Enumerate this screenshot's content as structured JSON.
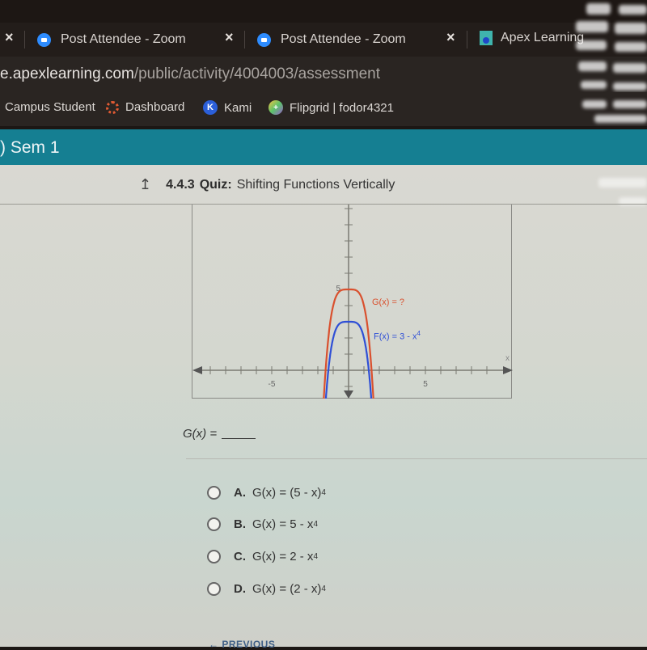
{
  "browser": {
    "tabs": [
      {
        "label": "Post Attendee - Zoom",
        "icon": "zoom-icon"
      },
      {
        "label": "Post Attendee - Zoom",
        "icon": "zoom-icon"
      },
      {
        "label": "Apex Learning",
        "icon": "apex-learning-icon"
      }
    ],
    "close_glyph": "×",
    "url_host": "e.apexlearning.com",
    "url_path": "/public/activity/4004003/assessment",
    "bookmarks": [
      {
        "label": "Campus Student",
        "icon": ""
      },
      {
        "label": "Dashboard",
        "icon": "dashboard-ring-icon"
      },
      {
        "label": "Kami",
        "icon": "kami-icon",
        "glyph": "K"
      },
      {
        "label": "Flipgrid | fodor4321",
        "icon": "flipgrid-icon",
        "glyph": "+"
      }
    ]
  },
  "course": {
    "banner_title": ") Sem 1"
  },
  "quiz": {
    "up_glyph": "↥",
    "number": "4.4.3",
    "type": "Quiz:",
    "title": "Shifting Functions Vertically",
    "question_prefix": "G(x) =",
    "options": [
      {
        "letter": "A.",
        "text": "G(x) = (5 - x)",
        "sup": "4"
      },
      {
        "letter": "B.",
        "text": "G(x) = 5 - x",
        "sup": "4"
      },
      {
        "letter": "C.",
        "text": "G(x) = 2 - x",
        "sup": "4"
      },
      {
        "letter": "D.",
        "text": "G(x) = (2 - x)",
        "sup": "4"
      }
    ],
    "previous_label": "← PREVIOUS"
  },
  "chart_data": {
    "type": "line",
    "title": "",
    "xlabel": "x",
    "ylabel": "",
    "xlim": [
      -10,
      10
    ],
    "ylim": [
      -2,
      10
    ],
    "x_tick_labels": [
      {
        "value": -5,
        "label": "-5"
      },
      {
        "value": 5,
        "label": "5"
      }
    ],
    "y_tick_labels": [
      {
        "value": 5,
        "label": "5"
      }
    ],
    "grid": false,
    "series": [
      {
        "name": "G(x) = ?",
        "label": "G(x) = ?",
        "color": "#d9502e",
        "formula": "5 - x^4",
        "vertical_shift": 5
      },
      {
        "name": "F(x) = 3 - x^4",
        "label": "F(x) = 3 - x",
        "label_sup": "4",
        "color": "#2f4fd6",
        "formula": "3 - x^4",
        "vertical_shift": 3
      }
    ]
  }
}
